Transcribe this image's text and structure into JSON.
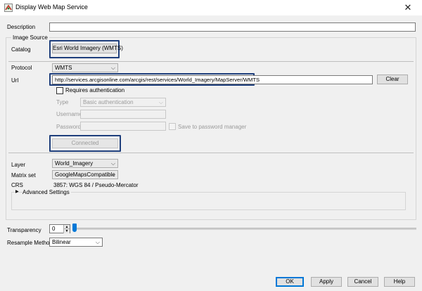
{
  "window": {
    "title": "Display Web Map Service",
    "close_glyph": "✕"
  },
  "description": {
    "label": "Description",
    "value": ""
  },
  "image_source": {
    "group_label": "Image Source",
    "catalog": {
      "label": "Catalog",
      "button": "Esri World Imagery (WMTS)"
    },
    "protocol": {
      "label": "Protocol",
      "value": "WMTS"
    },
    "url": {
      "label": "Url",
      "value": "http://services.arcgisonline.com/arcgis/rest/services/World_Imagery/MapServer/WMTS",
      "clear": "Clear"
    },
    "auth": {
      "requires_label": "Requires authentication",
      "type_label": "Type",
      "type_value": "Basic authentication",
      "username_label": "Username",
      "password_label": "Password",
      "save_label": "Save to password manager"
    },
    "connected_button": "Connected",
    "layer": {
      "label": "Layer",
      "value": "World_Imagery"
    },
    "matrix_set": {
      "label": "Matrix set",
      "value": "GoogleMapsCompatible"
    },
    "crs": {
      "label": "CRS",
      "value": "3857: WGS 84 / Pseudo-Mercator"
    },
    "advanced": {
      "label": "Advanced Settings",
      "expand_glyph": "▶"
    }
  },
  "transparency": {
    "label": "Transparency",
    "value": "0",
    "level": 0
  },
  "resample": {
    "label": "Resample Method",
    "value": "Bilinear"
  },
  "buttons": {
    "ok": "OK",
    "apply": "Apply",
    "cancel": "Cancel",
    "help": "Help"
  },
  "colors": {
    "accent": "#0078d7",
    "highlight": "#1f3f7c"
  }
}
